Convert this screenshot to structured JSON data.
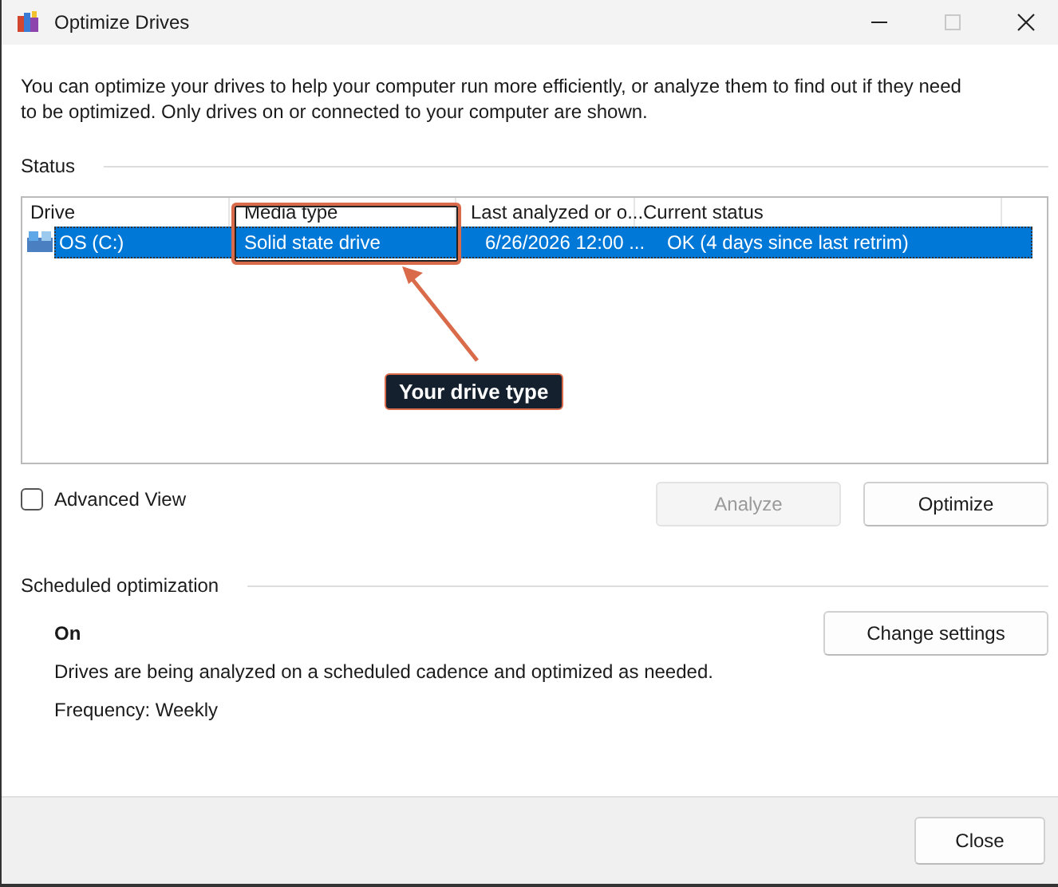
{
  "window": {
    "title": "Optimize Drives",
    "maximize_disabled": true
  },
  "description": "You can optimize your drives to help your computer run more efficiently, or analyze them to find out if they need to be optimized. Only drives on or connected to your computer are shown.",
  "status": {
    "label": "Status"
  },
  "table": {
    "columns": [
      "Drive",
      "Media type",
      "Last analyzed or o...",
      "Current status"
    ],
    "rows": [
      {
        "cells": [
          "OS (C:)",
          "Solid state drive",
          "6/26/2026 12:00 ...",
          "OK (4 days since last retrim)"
        ],
        "selected": true
      }
    ]
  },
  "annotation": {
    "label": "Your drive type"
  },
  "advanced_view": {
    "label": "Advanced View",
    "checked": false
  },
  "actions": [
    {
      "label": "Analyze",
      "disabled": true
    },
    {
      "label": "Optimize",
      "disabled": false
    }
  ],
  "scheduled": {
    "label": "Scheduled optimization",
    "state": "On",
    "description": "Drives are being analyzed on a scheduled cadence and optimized as needed.",
    "frequency": "Frequency: Weekly",
    "button": "Change settings"
  },
  "footer": {
    "button": "Close"
  }
}
